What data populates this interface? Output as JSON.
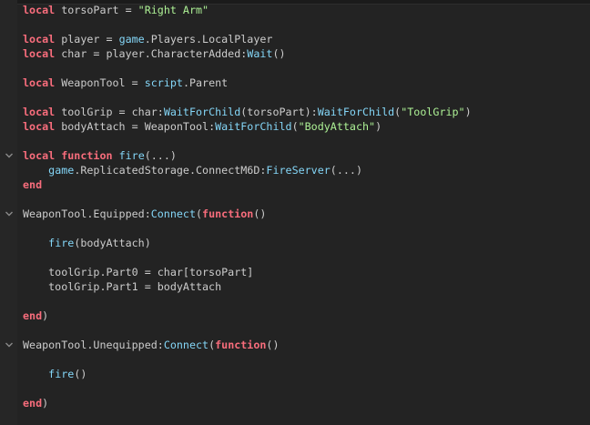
{
  "theme": {
    "background": "#232323",
    "gutter": "#262626",
    "default_text": "#cccccc",
    "keyword": "#f86d7c",
    "builtin": "#84d6f7",
    "string": "#adf195"
  },
  "code": {
    "lines": [
      [
        {
          "t": "local",
          "k": "kw"
        },
        {
          "t": " torsoPart = ",
          "k": "id"
        },
        {
          "t": "\"Right Arm\"",
          "k": "str"
        }
      ],
      [],
      [
        {
          "t": "local",
          "k": "kw"
        },
        {
          "t": " player = ",
          "k": "id"
        },
        {
          "t": "game",
          "k": "glb"
        },
        {
          "t": ".Players.LocalPlayer",
          "k": "id"
        }
      ],
      [
        {
          "t": "local",
          "k": "kw"
        },
        {
          "t": " char = player.CharacterAdded:",
          "k": "id"
        },
        {
          "t": "Wait",
          "k": "glb"
        },
        {
          "t": "()",
          "k": "id"
        }
      ],
      [],
      [
        {
          "t": "local",
          "k": "kw"
        },
        {
          "t": " WeaponTool = ",
          "k": "id"
        },
        {
          "t": "script",
          "k": "glb"
        },
        {
          "t": ".Parent",
          "k": "id"
        }
      ],
      [],
      [
        {
          "t": "local",
          "k": "kw"
        },
        {
          "t": " toolGrip = char:",
          "k": "id"
        },
        {
          "t": "WaitForChild",
          "k": "glb"
        },
        {
          "t": "(torsoPart):",
          "k": "id"
        },
        {
          "t": "WaitForChild",
          "k": "glb"
        },
        {
          "t": "(",
          "k": "id"
        },
        {
          "t": "\"ToolGrip\"",
          "k": "str"
        },
        {
          "t": ")",
          "k": "id"
        }
      ],
      [
        {
          "t": "local",
          "k": "kw"
        },
        {
          "t": " bodyAttach = WeaponTool:",
          "k": "id"
        },
        {
          "t": "WaitForChild",
          "k": "glb"
        },
        {
          "t": "(",
          "k": "id"
        },
        {
          "t": "\"BodyAttach\"",
          "k": "str"
        },
        {
          "t": ")",
          "k": "id"
        }
      ],
      [],
      [
        {
          "t": "local",
          "k": "kw"
        },
        {
          "t": " ",
          "k": "id"
        },
        {
          "t": "function",
          "k": "kw"
        },
        {
          "t": " ",
          "k": "id"
        },
        {
          "t": "fire",
          "k": "glb"
        },
        {
          "t": "(...)",
          "k": "id"
        }
      ],
      [
        {
          "t": "    ",
          "k": "id"
        },
        {
          "t": "game",
          "k": "glb"
        },
        {
          "t": ".ReplicatedStorage.ConnectM6D:",
          "k": "id"
        },
        {
          "t": "FireServer",
          "k": "glb"
        },
        {
          "t": "(...)",
          "k": "id"
        }
      ],
      [
        {
          "t": "end",
          "k": "kw"
        }
      ],
      [],
      [
        {
          "t": "WeaponTool.Equipped:",
          "k": "id"
        },
        {
          "t": "Connect",
          "k": "glb"
        },
        {
          "t": "(",
          "k": "id"
        },
        {
          "t": "function",
          "k": "kw"
        },
        {
          "t": "()",
          "k": "id"
        }
      ],
      [],
      [
        {
          "t": "    ",
          "k": "id"
        },
        {
          "t": "fire",
          "k": "glb"
        },
        {
          "t": "(bodyAttach)",
          "k": "id"
        }
      ],
      [],
      [
        {
          "t": "    toolGrip.Part0 = char[torsoPart]",
          "k": "id"
        }
      ],
      [
        {
          "t": "    toolGrip.Part1 = bodyAttach",
          "k": "id"
        }
      ],
      [],
      [
        {
          "t": "end",
          "k": "kw"
        },
        {
          "t": ")",
          "k": "id"
        }
      ],
      [],
      [
        {
          "t": "WeaponTool.Unequipped:",
          "k": "id"
        },
        {
          "t": "Connect",
          "k": "glb"
        },
        {
          "t": "(",
          "k": "id"
        },
        {
          "t": "function",
          "k": "kw"
        },
        {
          "t": "()",
          "k": "id"
        }
      ],
      [],
      [
        {
          "t": "    ",
          "k": "id"
        },
        {
          "t": "fire",
          "k": "glb"
        },
        {
          "t": "()",
          "k": "id"
        }
      ],
      [],
      [
        {
          "t": "end",
          "k": "kw"
        },
        {
          "t": ")",
          "k": "id"
        }
      ]
    ],
    "fold_lines": [
      10,
      14,
      23
    ]
  }
}
